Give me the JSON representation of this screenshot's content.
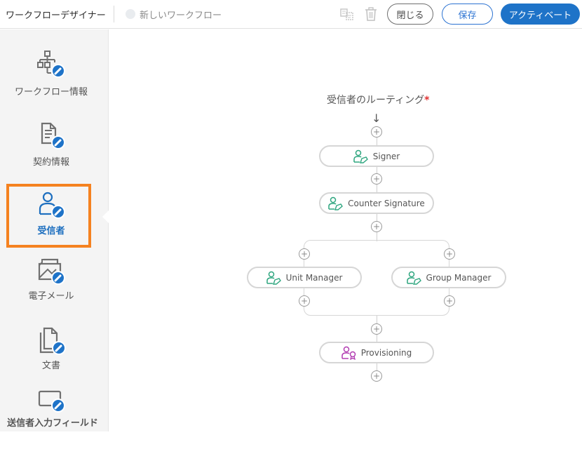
{
  "header": {
    "app_title": "ワークフローデザイナー",
    "workflow_name": "新しいワークフロー",
    "icons": [
      "copy-icon",
      "trash-icon"
    ],
    "buttons": {
      "close": "閉じる",
      "save": "保存",
      "activate": "アクティベート"
    },
    "colors": {
      "primary": "#1e73c8",
      "highlight": "#f58220"
    }
  },
  "sidebar": {
    "items": [
      {
        "label": "ワークフロー情報",
        "icon": "workflow-icon",
        "active": false
      },
      {
        "label": "契約情報",
        "icon": "document-info-icon",
        "active": false
      },
      {
        "label": "受信者",
        "icon": "recipient-icon",
        "active": true
      },
      {
        "label": "電子メール",
        "icon": "email-icon",
        "active": false
      },
      {
        "label": "文書",
        "icon": "documents-icon",
        "active": false
      },
      {
        "label": "送信者入力フィールド",
        "icon": "sender-field-icon",
        "active": false
      }
    ]
  },
  "routing": {
    "title": "受信者のルーティング",
    "required_mark": "*",
    "add_symbol": "+",
    "nodes": [
      {
        "label": "Signer",
        "role": "signer",
        "color": "#2ea67f"
      },
      {
        "label": "Counter Signature",
        "role": "signer",
        "color": "#2ea67f"
      },
      {
        "label": "Unit Manager",
        "role": "signer",
        "color": "#2ea67f"
      },
      {
        "label": "Group Manager",
        "role": "signer",
        "color": "#2ea67f"
      },
      {
        "label": "Provisioning",
        "role": "certified-recipient",
        "color": "#b23db2"
      }
    ]
  }
}
